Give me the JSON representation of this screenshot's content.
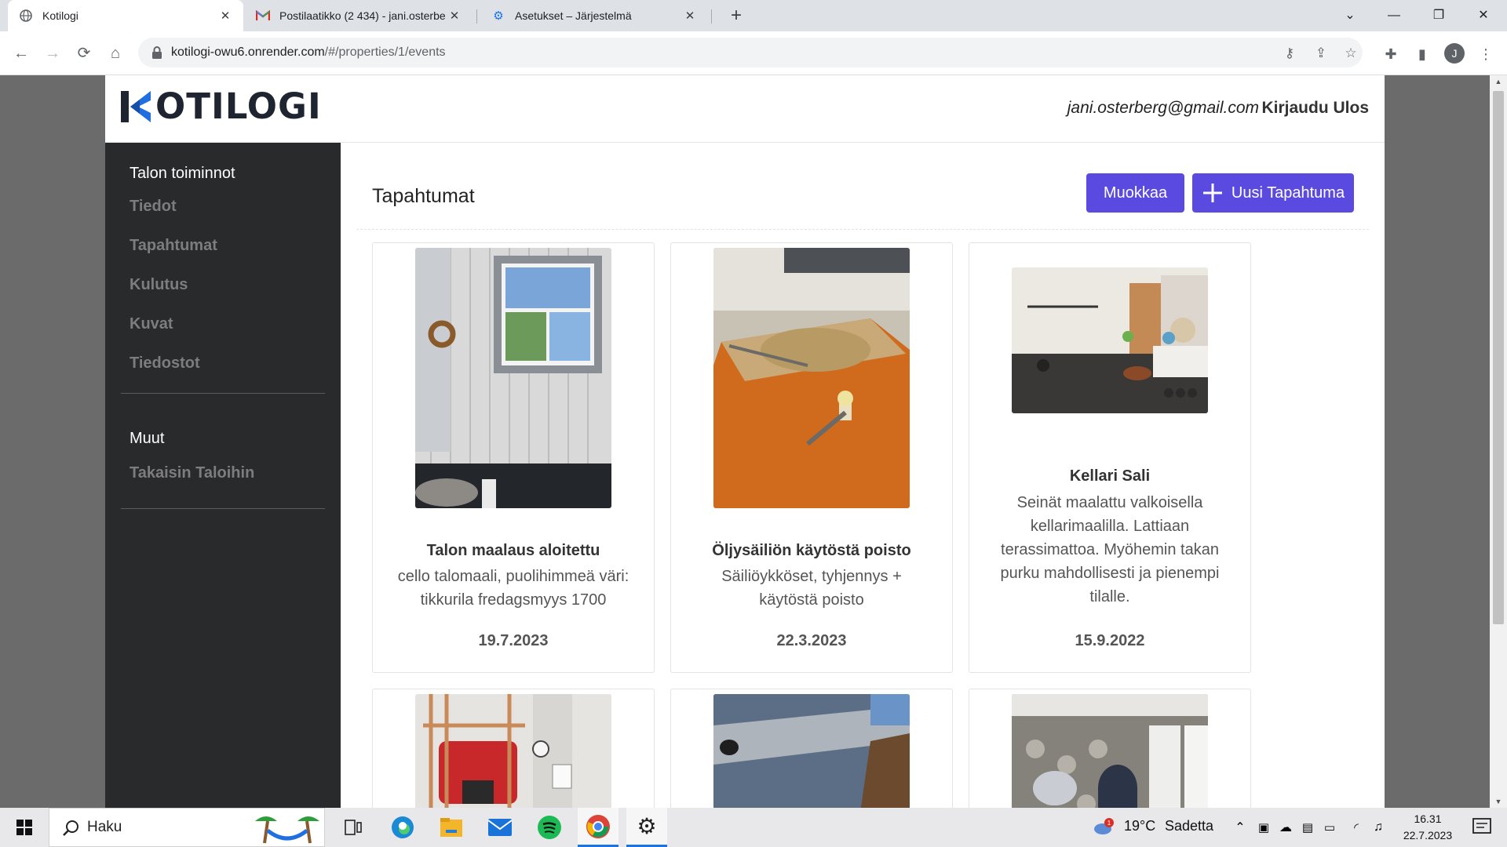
{
  "browser": {
    "tabs": [
      {
        "title": "Kotilogi",
        "icon": "globe-icon"
      },
      {
        "title": "Postilaatikko (2 434) - jani.osterbe",
        "icon": "gmail-icon"
      },
      {
        "title": "Asetukset – Järjestelmä",
        "icon": "gear-icon"
      }
    ],
    "url_host": "kotilogi-owu6.onrender.com",
    "url_path": "/#/properties/1/events",
    "profile_initial": "J"
  },
  "header": {
    "logo_text": "OTILOGI",
    "user_email": "jani.osterberg@gmail.com",
    "logout_label": "Kirjaudu Ulos"
  },
  "sidebar": {
    "section1_title": "Talon toiminnot",
    "items": [
      {
        "label": "Tiedot"
      },
      {
        "label": "Tapahtumat"
      },
      {
        "label": "Kulutus"
      },
      {
        "label": "Kuvat"
      },
      {
        "label": "Tiedostot"
      }
    ],
    "section2_title": "Muut",
    "back_label": "Takaisin Taloihin"
  },
  "main": {
    "title": "Tapahtumat",
    "edit_label": "Muokkaa",
    "new_label": "Uusi Tapahtuma",
    "events": [
      {
        "title": "Talon maalaus aloitettu",
        "description": "cello talomaali, puolihimmeä väri: tikkurila fredagsmyys 1700",
        "date": "19.7.2023"
      },
      {
        "title": "Öljysäiliön käytöstä poisto",
        "description": "Säiliöykköset, tyhjennys + käytöstä poisto",
        "date": "22.3.2023"
      },
      {
        "title": "Kellari Sali",
        "description": "Seinät maalattu valkoisella kellarimaalilla. Lattiaan terassimattoa. Myöhemin takan purku mahdollisesti ja pienempi tilalle.",
        "date": "15.9.2022"
      }
    ]
  },
  "taskbar": {
    "search_label": "Haku",
    "weather_temp": "19°C",
    "weather_text": "Sadetta",
    "time": "16.31",
    "date": "22.7.2023",
    "notification_count": "1"
  },
  "colors": {
    "accent": "#5b4ae0",
    "sidebar_bg": "#292a2c",
    "logo_blue": "#1f6fe0"
  }
}
